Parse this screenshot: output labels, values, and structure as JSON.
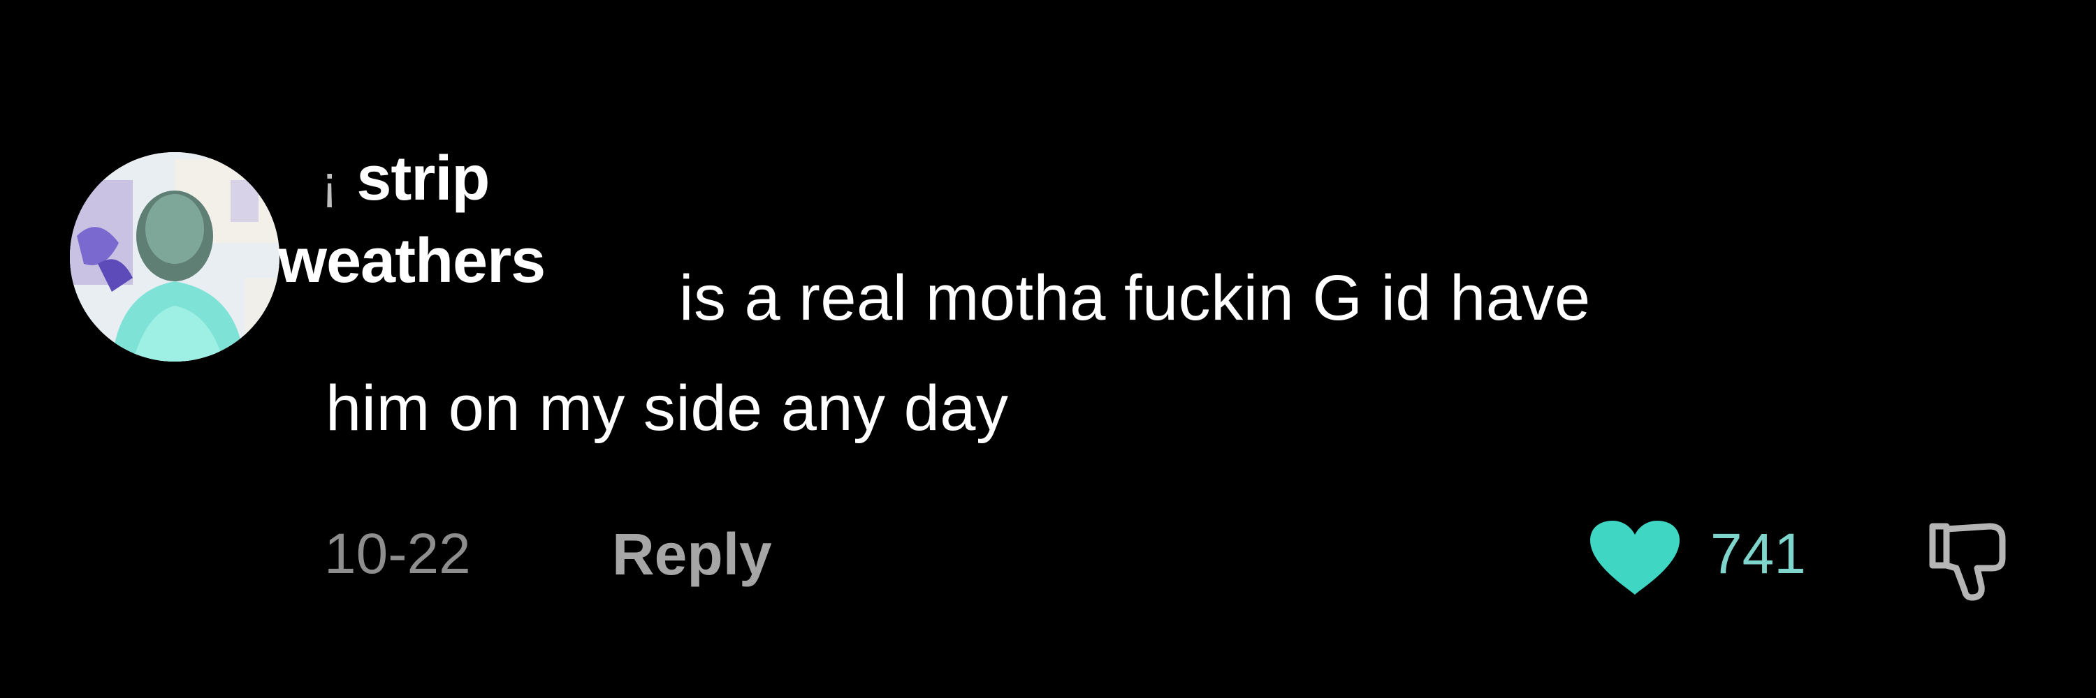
{
  "comment": {
    "username_lead_glyph": "¡",
    "username_line1": "strip",
    "username_line2": "weathers",
    "text_line1": "is a real motha fuckin G id have",
    "text_line2": "him on my side any day",
    "date": "10-22",
    "reply_label": "Reply",
    "like_count": "741"
  },
  "icons": {
    "avatar": "avatar",
    "like": "heart-icon",
    "dislike": "thumbs-down-icon"
  },
  "colors": {
    "background": "#000000",
    "text": "#ffffff",
    "muted": "#8e8e8e",
    "like_accent": "#3fd6c3"
  }
}
